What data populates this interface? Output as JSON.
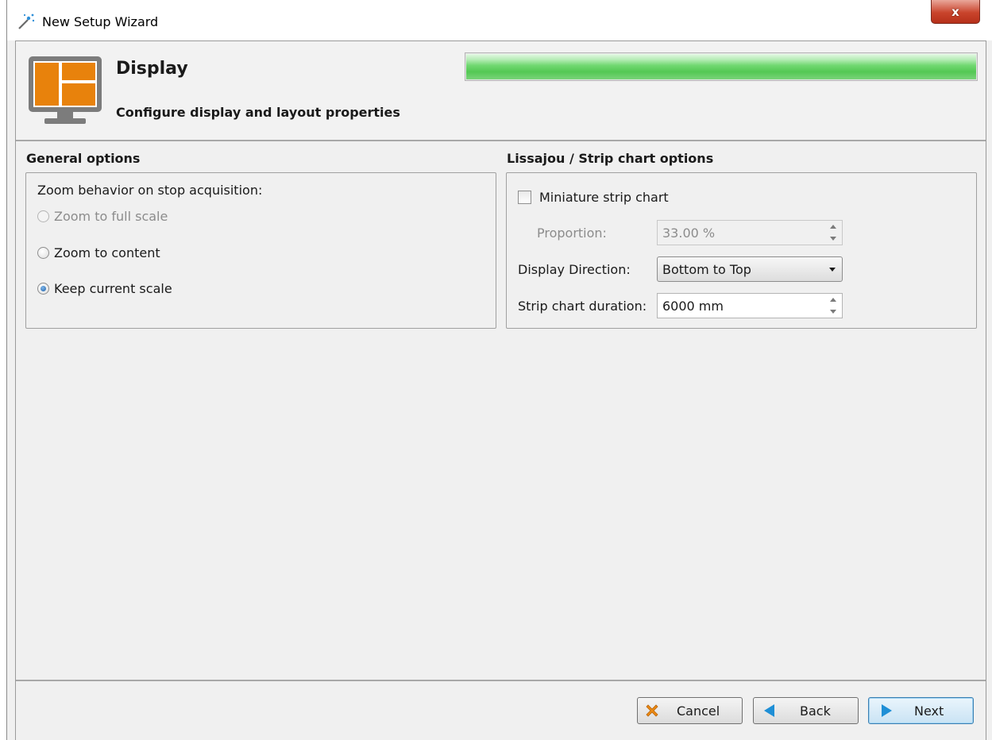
{
  "window": {
    "title": "New Setup Wizard",
    "close_label": "x"
  },
  "header": {
    "title": "Display",
    "subtitle": "Configure display and layout properties",
    "icon": "display-layout-icon",
    "progress_fraction": 1.0
  },
  "general_options": {
    "label": "General options",
    "zoom_label": "Zoom behavior on stop acquisition:",
    "options": [
      {
        "label": "Zoom to full scale",
        "checked": false,
        "enabled": false
      },
      {
        "label": "Zoom to content",
        "checked": false,
        "enabled": true
      },
      {
        "label": "Keep current scale",
        "checked": true,
        "enabled": true
      }
    ]
  },
  "strip_chart_options": {
    "label": "Lissajou / Strip chart options",
    "miniature_label": "Miniature strip chart",
    "miniature_checked": false,
    "proportion_label": "Proportion:",
    "proportion_value": "33.00 %",
    "direction_label": "Display Direction:",
    "direction_value": "Bottom to Top",
    "duration_label": "Strip chart duration:",
    "duration_value": "6000 mm"
  },
  "footer": {
    "cancel_label": "Cancel",
    "back_label": "Back",
    "next_label": "Next"
  },
  "colors": {
    "accent_orange": "#e8820c",
    "progress_green": "#54c854",
    "icon_blue": "#1f8fd6"
  }
}
